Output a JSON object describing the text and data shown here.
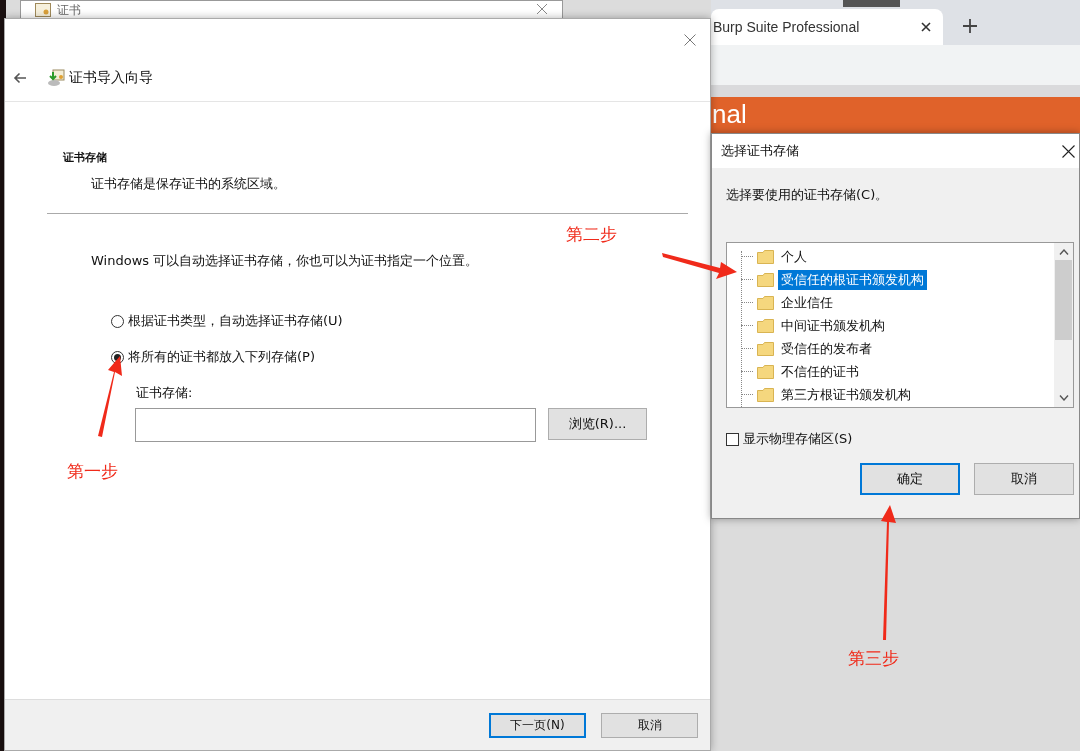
{
  "background_window": {
    "title": "证书"
  },
  "browser": {
    "tab_title": "Burp Suite Professional",
    "page_heading_fragment": "nal"
  },
  "wizard": {
    "title": "证书导入向导",
    "section_title": "证书存储",
    "section_desc": "证书存储是保存证书的系统区域。",
    "intro": "Windows 可以自动选择证书存储，你也可以为证书指定一个位置。",
    "options": [
      {
        "label": "根据证书类型，自动选择证书存储(U)",
        "selected": false
      },
      {
        "label": "将所有的证书都放入下列存储(P)",
        "selected": true
      }
    ],
    "store_label": "证书存储:",
    "browse_button": "浏览(R)...",
    "buttons": [
      {
        "label": "下一页(N)",
        "kind": "default"
      },
      {
        "label": "取消",
        "kind": "normal"
      }
    ]
  },
  "dialog": {
    "title": "选择证书存储",
    "prompt": "选择要使用的证书存储(C)。",
    "stores": [
      {
        "label": "个人",
        "selected": false
      },
      {
        "label": "受信任的根证书颁发机构",
        "selected": true
      },
      {
        "label": "企业信任",
        "selected": false
      },
      {
        "label": "中间证书颁发机构",
        "selected": false
      },
      {
        "label": "受信任的发布者",
        "selected": false
      },
      {
        "label": "不信任的证书",
        "selected": false
      },
      {
        "label": "第三方根证书颁发机构",
        "selected": false
      }
    ],
    "show_physical": {
      "label": "显示物理存储区(S)",
      "checked": false
    },
    "buttons": [
      {
        "label": "确定",
        "kind": "default"
      },
      {
        "label": "取消",
        "kind": "normal"
      }
    ]
  },
  "annotations": [
    {
      "text": "第一步"
    },
    {
      "text": "第二步"
    },
    {
      "text": "第三步"
    }
  ]
}
